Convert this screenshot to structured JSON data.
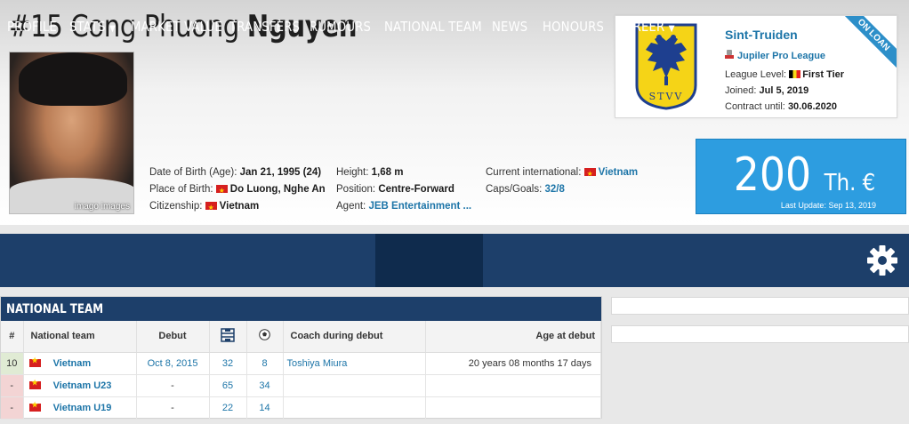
{
  "player": {
    "number": "#15",
    "first_names": "Cong Phuong",
    "last_name": "Nguyen",
    "photo_credit": "imago images"
  },
  "info": {
    "dob_label": "Date of Birth (Age):",
    "dob_value": "Jan 21, 1995 (24)",
    "pob_label": "Place of Birth:",
    "pob_value": "Do Luong, Nghe An",
    "citizenship_label": "Citizenship:",
    "citizenship_value": "Vietnam",
    "height_label": "Height:",
    "height_value": "1,68 m",
    "position_label": "Position:",
    "position_value": "Centre-Forward",
    "agent_label": "Agent:",
    "agent_value": "JEB Entertainment ...",
    "current_int_label": "Current international:",
    "current_int_value": "Vietnam",
    "caps_label": "Caps/Goals:",
    "caps_value": "32/8"
  },
  "club": {
    "name": "Sint-Truiden",
    "crest_text": "STVV",
    "league": "Jupiler Pro League",
    "level_label": "League Level:",
    "level_value": "First Tier",
    "joined_label": "Joined:",
    "joined_value": "Jul 5, 2019",
    "contract_label": "Contract until:",
    "contract_value": "30.06.2020",
    "ribbon": "ON LOAN",
    "colors": {
      "crest_yellow": "#f5d417",
      "crest_blue": "#1e3f8f"
    }
  },
  "market_value": {
    "amount": "200",
    "currency": "Th. €",
    "last_update": "Last Update: Sep 13, 2019"
  },
  "nav": {
    "items": [
      "PROFILE",
      "STATS",
      "MARKET VALUE",
      "TRANSFERS",
      "RUMOURS",
      "NATIONAL TEAM",
      "NEWS",
      "HONOURS",
      "CAREER"
    ],
    "active": "NATIONAL TEAM",
    "settings_icon": "gear-icon"
  },
  "national_team": {
    "title": "NATIONAL TEAM",
    "columns": [
      "#",
      "National team",
      "Debut",
      "",
      "",
      "Coach during debut",
      "Age at debut"
    ],
    "column_icons": [
      "",
      "",
      "",
      "appearances-icon",
      "ball-icon",
      "",
      ""
    ],
    "rows": [
      {
        "num": "10",
        "team": "Vietnam",
        "debut": "Oct 8, 2015",
        "apps": "32",
        "goals": "8",
        "coach": "Toshiya Miura",
        "age": "20 years 08 months 17 days"
      },
      {
        "num": "-",
        "team": "Vietnam U23",
        "debut": "-",
        "apps": "65",
        "goals": "34",
        "coach": "",
        "age": ""
      },
      {
        "num": "-",
        "team": "Vietnam U19",
        "debut": "-",
        "apps": "22",
        "goals": "14",
        "coach": "",
        "age": ""
      }
    ]
  },
  "colors": {
    "nav_bg": "#1d3f6a",
    "nav_active": "#0f2b4d",
    "link": "#1d75a8",
    "market_value_bg": "#2d9de0",
    "flag_vn": "#d61f1f"
  }
}
